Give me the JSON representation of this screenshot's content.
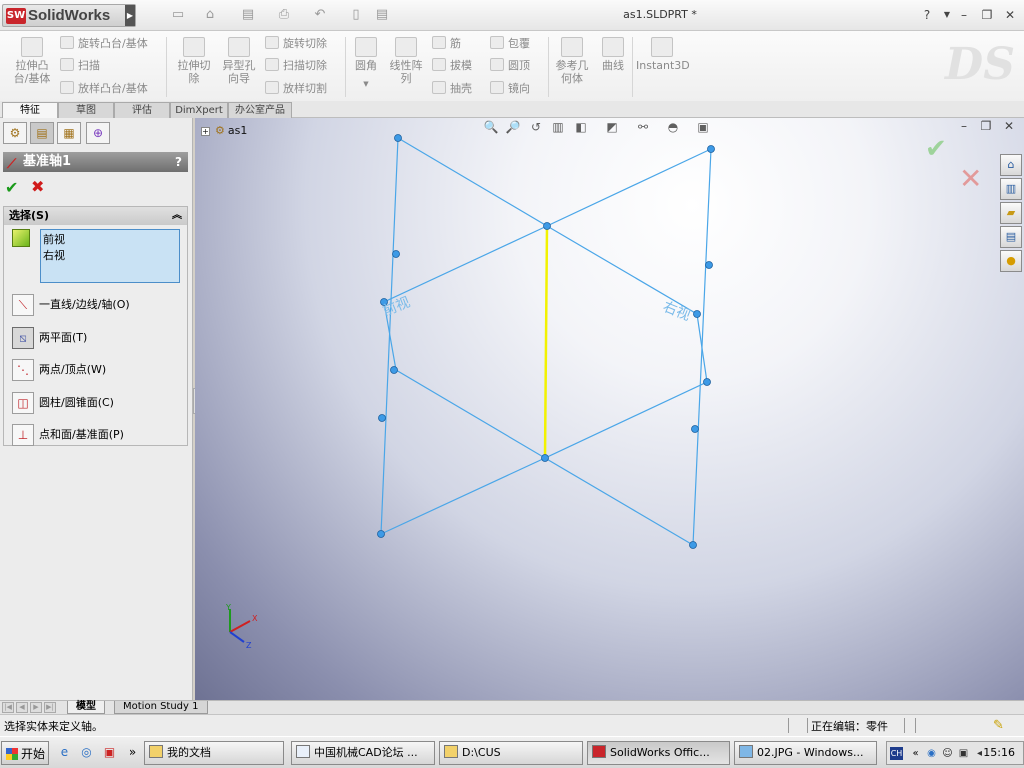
{
  "app": {
    "brand": "SolidWorks",
    "brand_badge": "SW",
    "document_title": "as1.SLDPRT *",
    "help": "?",
    "window_controls": {
      "minimize": "–",
      "restore": "❐",
      "close": "✕"
    }
  },
  "command_manager": {
    "extrude_boss": "拉伸凸\n台/基体",
    "revolve_boss": "旋转凸台/基体",
    "sweep": "扫描",
    "loft_boss": "放样凸台/基体",
    "extrude_cut": "拉伸切\n除",
    "hole_wizard": "异型孔\n向导",
    "revolve_cut": "旋转切除",
    "swept_cut": "扫描切除",
    "lofted_cut": "放样切割",
    "fillet": "圆角",
    "linear_pattern": "线性阵\n列",
    "rib": "筋",
    "draft": "拔模",
    "shell": "抽壳",
    "wrap": "包覆",
    "dome": "圆顶",
    "mirror": "镜向",
    "reference_geometry": "参考几\n何体",
    "curves": "曲线",
    "instant3d": "Instant3D"
  },
  "tabs": [
    "特征",
    "草图",
    "评估",
    "DimXpert",
    "办公室产品"
  ],
  "property_manager": {
    "title": "基准轴1",
    "help": "?",
    "ok": "✔",
    "cancel": "✖",
    "selection": {
      "header": "选择(S)",
      "items": [
        "前视",
        "右视"
      ]
    },
    "options": [
      {
        "label": "一直线/边线/轴(O)",
        "icon": "line-edge-icon",
        "selected": false
      },
      {
        "label": "两平面(T)",
        "icon": "two-planes-icon",
        "selected": true
      },
      {
        "label": "两点/顶点(W)",
        "icon": "two-points-icon",
        "selected": false
      },
      {
        "label": "圆柱/圆锥面(C)",
        "icon": "cylinder-icon",
        "selected": false
      },
      {
        "label": "点和面/基准面(P)",
        "icon": "point-plane-icon",
        "selected": false
      }
    ]
  },
  "viewport": {
    "tree_root": "as1",
    "plane_labels": {
      "front": "前视",
      "right": "右视"
    },
    "axis_color": "#f2f200",
    "plane_color": "#4aa6e8"
  },
  "bottom_tabs": [
    "模型",
    "Motion Study 1"
  ],
  "status": {
    "message": "选择实体来定义轴。",
    "editing": "正在编辑：零件"
  },
  "taskbar": {
    "start": "开始",
    "tasks": [
      {
        "label": "我的文档",
        "active": false
      },
      {
        "label": "中国机械CAD论坛 ...",
        "active": false
      },
      {
        "label": "D:\\CUS",
        "active": false
      },
      {
        "label": "SolidWorks Offic...",
        "active": true
      },
      {
        "label": "02.JPG - Windows...",
        "active": false
      }
    ],
    "tray_lang": "CH",
    "clock": "15:16"
  }
}
